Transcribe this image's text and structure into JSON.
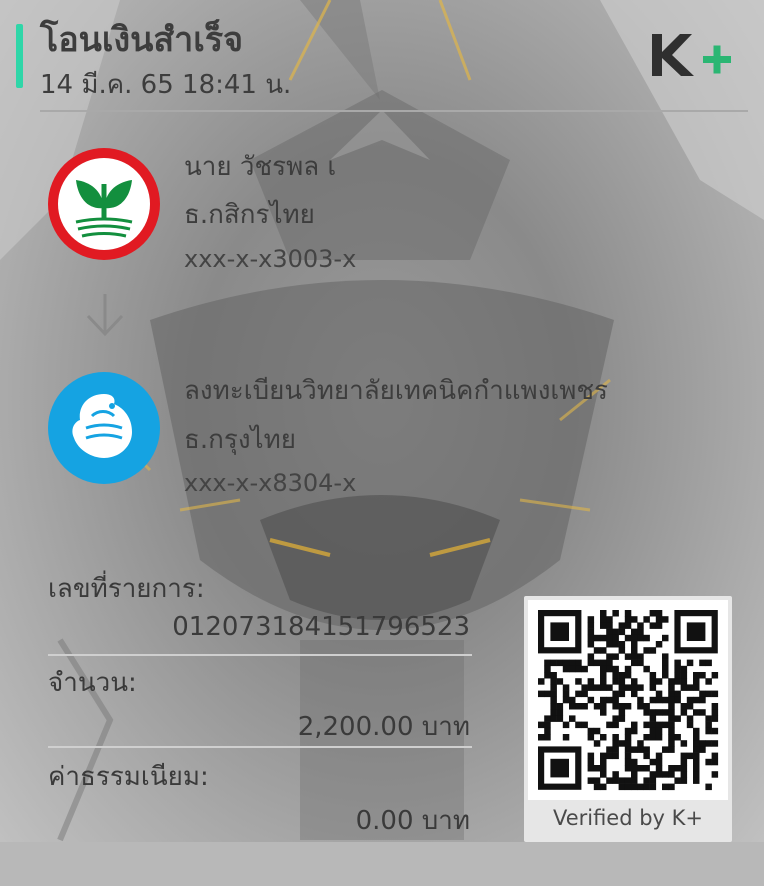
{
  "header": {
    "title": "โอนเงินสำเร็จ",
    "datetime": "14 มี.ค. 65  18:41 น."
  },
  "brand": {
    "logo_text": "K+",
    "accent_color": "#2fd6a8",
    "logo_green": "#2bb673"
  },
  "sender": {
    "name": "นาย วัชรพล เ",
    "bank": "ธ.กสิกรไทย",
    "account": "xxx-x-x3003-x",
    "bank_icon": "kasikorn-logo-icon"
  },
  "receiver": {
    "name": "ลงทะเบียนวิทยาลัยเทคนิคกำแพงเพชร",
    "bank": "ธ.กรุงไทย",
    "account": "xxx-x-x8304-x",
    "bank_icon": "krungthai-logo-icon"
  },
  "transaction": {
    "ref_label": "เลขที่รายการ:",
    "ref_value": "012073184151796523",
    "amount_label": "จำนวน:",
    "amount_value": "2,200.00 บาท",
    "fee_label": "ค่าธรรมเนียม:",
    "fee_value": "0.00 บาท"
  },
  "qr": {
    "verified_text": "Verified by K+",
    "icon": "qr-code-icon"
  }
}
